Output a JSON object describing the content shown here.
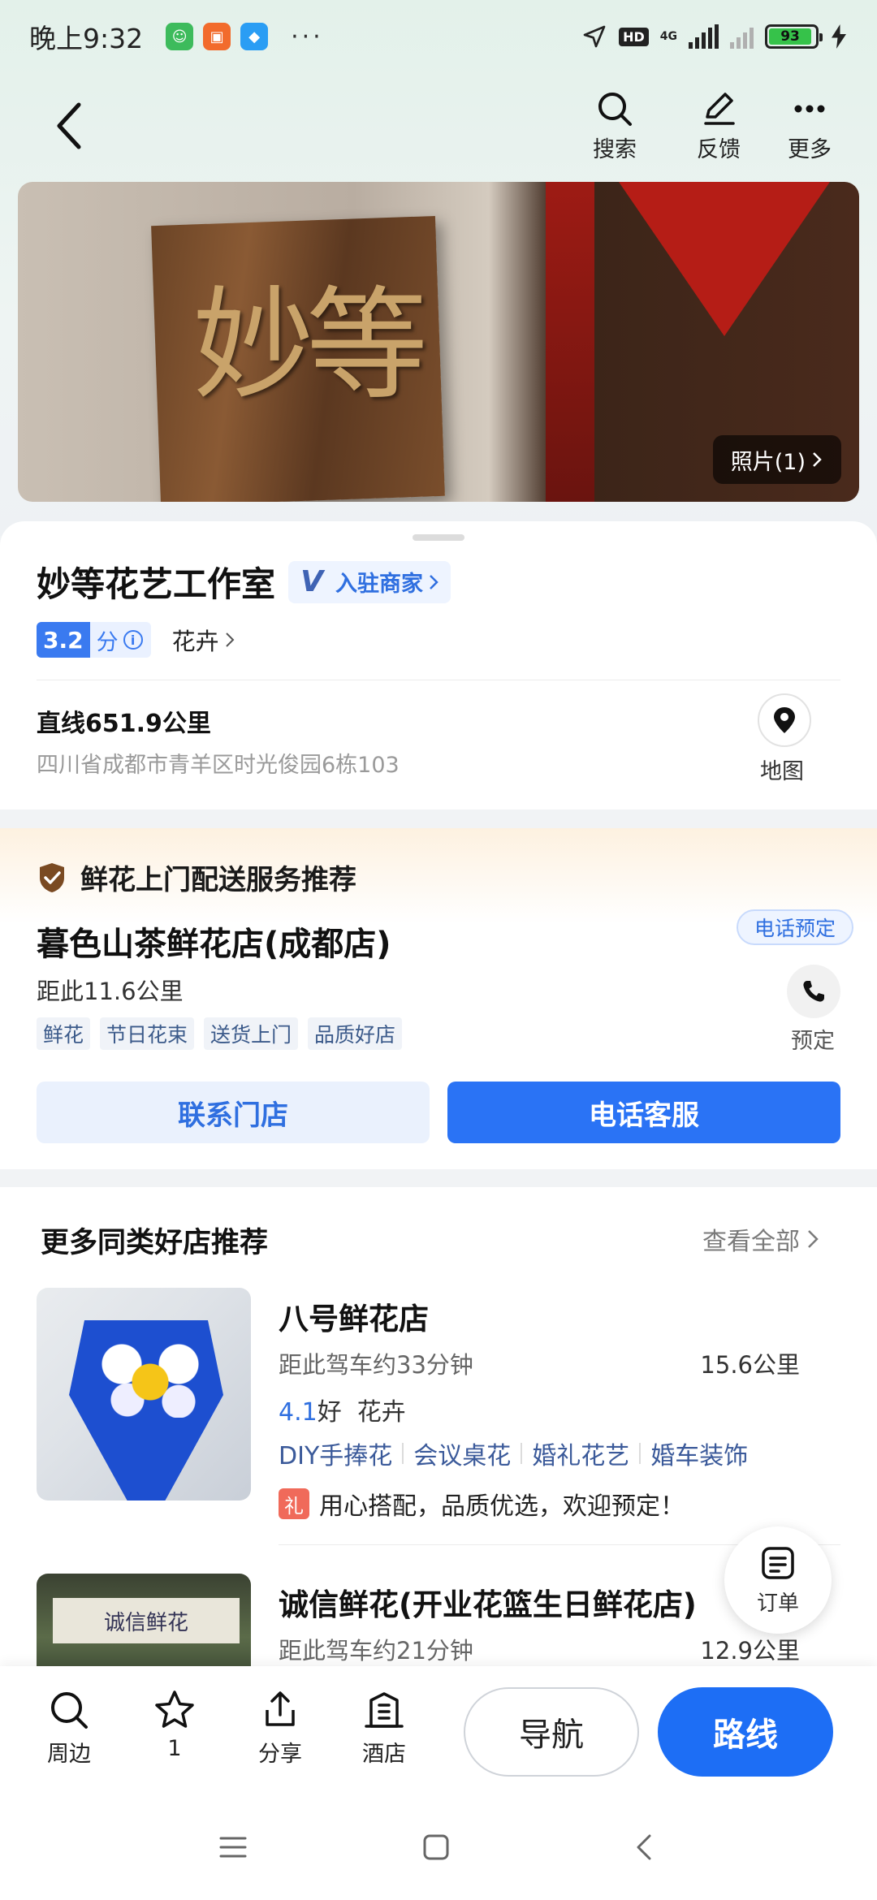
{
  "status_bar": {
    "time": "晚上9:32",
    "dots": "···",
    "hd": "HD",
    "network": "4G",
    "battery": "93",
    "battery_level": 0.93
  },
  "header": {
    "search_label": "搜索",
    "feedback_label": "反馈",
    "more_label": "更多"
  },
  "banner": {
    "sign_text": "妙等",
    "photo_count_label": "照片(1)"
  },
  "shop": {
    "name": "妙等花艺工作室",
    "merchant_badge": "入驻商家",
    "badge_mark": "V",
    "rating": "3.2",
    "rating_unit": "分",
    "category": "花卉",
    "distance": "直线651.9公里",
    "address": "四川省成都市青羊区时光俊园6栋103",
    "map_label": "地图"
  },
  "promo": {
    "title": "鲜花上门配送服务推荐",
    "shop_name": "暮色山茶鲜花店(成都店)",
    "distance": "距此11.6公里",
    "tags": [
      "鲜花",
      "节日花束",
      "送货上门",
      "品质好店"
    ],
    "call_bubble": "电话预定",
    "phone_label": "预定",
    "contact_button": "联系门店",
    "call_button": "电话客服"
  },
  "recommend": {
    "title": "更多同类好店推荐",
    "view_all": "查看全部",
    "items": [
      {
        "name": "八号鲜花店",
        "drive": "距此驾车约33分钟",
        "km": "15.6公里",
        "rating": "4.1",
        "rating_word": "好",
        "category": "花卉",
        "tags": [
          "DIY手捧花",
          "会议桌花",
          "婚礼花艺",
          "婚车装饰"
        ],
        "gift_badge": "礼",
        "gift_text": "用心搭配，品质优选，欢迎预定！"
      },
      {
        "name": "诚信鲜花(开业花篮生日鲜花店)",
        "drive": "距此驾车约21分钟",
        "km": "12.9公里",
        "thumb_sign": "诚信鲜花"
      }
    ]
  },
  "order_fab": {
    "label": "订单"
  },
  "bottom_bar": {
    "nearby": "周边",
    "favorite": "1",
    "share": "分享",
    "hotel": "酒店",
    "navigate": "导航",
    "route": "路线"
  },
  "colors": {
    "accent": "#2a73f5",
    "route_button": "#1d6ef5",
    "rating_bg": "#3a7af0",
    "battery": "#36c24a"
  }
}
